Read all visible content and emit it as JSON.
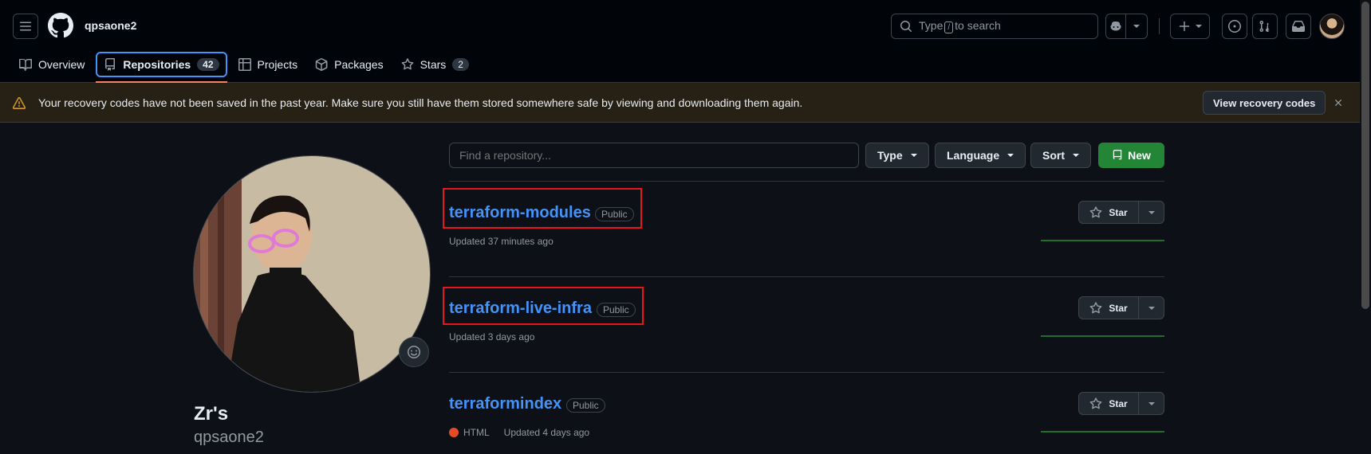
{
  "header": {
    "username": "qpsaone2",
    "search": {
      "prefix": "Type",
      "key": "/",
      "suffix": "to search"
    }
  },
  "tabs": [
    {
      "label": "Overview"
    },
    {
      "label": "Repositories",
      "count": "42"
    },
    {
      "label": "Projects"
    },
    {
      "label": "Packages"
    },
    {
      "label": "Stars",
      "count": "2"
    }
  ],
  "flash": {
    "message": "Your recovery codes have not been saved in the past year. Make sure you still have them stored somewhere safe by viewing and downloading them again.",
    "button": "View recovery codes"
  },
  "profile": {
    "name": "Zr's",
    "login": "qpsaone2"
  },
  "filters": {
    "placeholder": "Find a repository...",
    "type": "Type",
    "language": "Language",
    "sort": "Sort",
    "new": "New"
  },
  "repos": [
    {
      "name": "terraform-modules",
      "visibility": "Public",
      "updated": "Updated 37 minutes ago",
      "language": "",
      "star": "Star"
    },
    {
      "name": "terraform-live-infra",
      "visibility": "Public",
      "updated": "Updated 3 days ago",
      "language": "",
      "star": "Star"
    },
    {
      "name": "terraformindex",
      "visibility": "Public",
      "updated": "Updated 4 days ago",
      "language": "HTML",
      "star": "Star"
    }
  ],
  "colors": {
    "accent": "#4493f8",
    "new_button": "#238636",
    "flash_bg": "#272115",
    "highlight": "#e5161c",
    "html_language": "#e34c26"
  }
}
